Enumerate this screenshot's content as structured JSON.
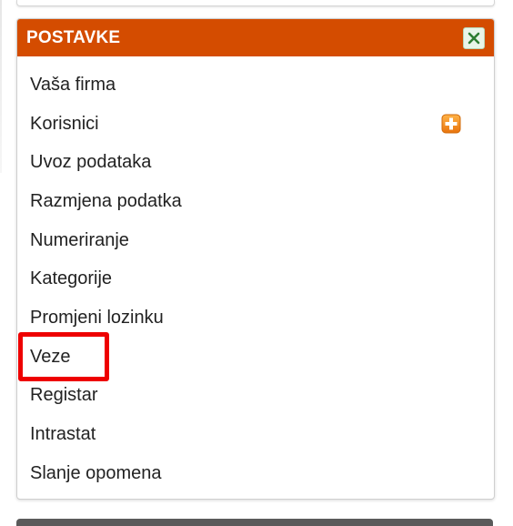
{
  "panel": {
    "title": "POSTAVKE",
    "header_color": "#d44c00",
    "close_icon": "close-icon",
    "items": [
      {
        "label": "Vaša firma"
      },
      {
        "label": "Korisnici",
        "icon": "plus-icon"
      },
      {
        "label": "Uvoz podataka"
      },
      {
        "label": "Razmjena podatka"
      },
      {
        "label": "Numeriranje"
      },
      {
        "label": "Kategorije"
      },
      {
        "label": "Promjeni lozinku"
      },
      {
        "label": "Veze",
        "highlighted": true
      },
      {
        "label": "Registar"
      },
      {
        "label": "Intrastat"
      },
      {
        "label": "Slanje opomena"
      }
    ]
  },
  "colors": {
    "highlight": "#ee0000",
    "plus_icon": "#f28c1c"
  }
}
